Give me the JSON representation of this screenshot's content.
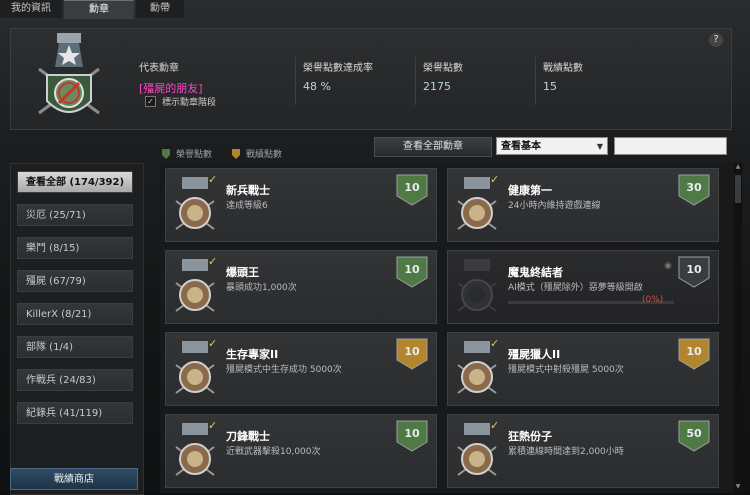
{
  "tabs": [
    "我的資訊",
    "勳章",
    "勳帶"
  ],
  "header": {
    "rep_label": "代表勳章",
    "rep_name": "[殭屍的朋友]",
    "show_stage": "標示勳章階段",
    "cols": [
      {
        "label": "榮譽點數達成率",
        "value": "48 %"
      },
      {
        "label": "榮譽點數",
        "value": "2175"
      },
      {
        "label": "戰績點數",
        "value": "15"
      }
    ]
  },
  "legend": {
    "honor": "榮譽點數",
    "record": "戰績點數"
  },
  "controls": {
    "view_all": "查看全部勳章",
    "filter": "查看基本"
  },
  "sidebar": [
    {
      "label": "查看全部 (174/392)",
      "active": true
    },
    {
      "label": "災厄 (25/71)"
    },
    {
      "label": "樂鬥 (8/15)"
    },
    {
      "label": "殭屍 (67/79)"
    },
    {
      "label": "KillerX (8/21)"
    },
    {
      "label": "部隊 (1/4)"
    },
    {
      "label": "作戰兵 (24/83)"
    },
    {
      "label": "紀錄兵 (41/119)"
    }
  ],
  "shop_label": "戰績商店",
  "medals": [
    {
      "title": "新兵戰士",
      "desc": "達成等級6",
      "points": "10",
      "shield": "green",
      "done": true,
      "icon": "welcome-medal-icon"
    },
    {
      "title": "健康第一",
      "desc": "24小時內維持遊戲連線",
      "points": "30",
      "shield": "green",
      "done": true,
      "icon": "star-medal-icon"
    },
    {
      "title": "爆頭王",
      "desc": "暴頭成功1,000次",
      "points": "10",
      "shield": "green",
      "done": true,
      "icon": "skull-medal-icon"
    },
    {
      "title": "魔鬼終結者",
      "desc": "AI模式（殭屍除外）惡夢等級開啟",
      "points": "10",
      "shield": "gray",
      "done": false,
      "progress": "(0%)",
      "icon": "locked-medal-icon"
    },
    {
      "title": "生存專家II",
      "desc": "殭屍模式中生存成功 5000次",
      "points": "10",
      "shield": "gold",
      "done": true,
      "icon": "survival-medal-icon"
    },
    {
      "title": "殭屍獵人II",
      "desc": "殭屍模式中射殺殭屍 5000次",
      "points": "10",
      "shield": "gold",
      "done": true,
      "icon": "hunter-medal-icon"
    },
    {
      "title": "刀鋒戰士",
      "desc": "近戰武器擊殺10,000次",
      "points": "10",
      "shield": "green",
      "done": true,
      "icon": "blade-medal-icon"
    },
    {
      "title": "狂熱份子",
      "desc": "累積連線時間達到2,000小時",
      "points": "50",
      "shield": "green",
      "done": true,
      "icon": "wings-medal-icon"
    }
  ],
  "colors": {
    "honor": "#4f7a45",
    "record": "#b3862e",
    "rep": "#ff44c8"
  }
}
